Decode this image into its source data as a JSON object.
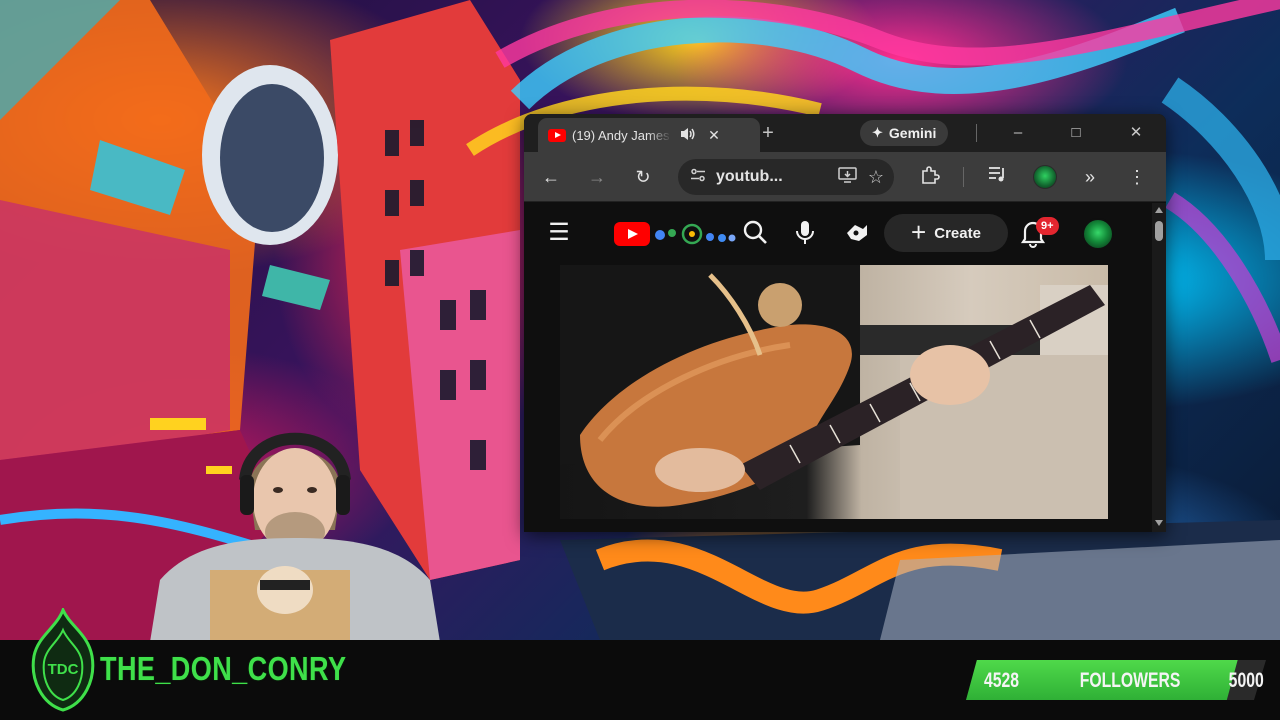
{
  "browser": {
    "tab": {
      "title": "(19) Andy James",
      "audio_icon": "speaker-icon",
      "close_icon": "close-icon"
    },
    "new_tab_label": "+",
    "gemini_label": "Gemini",
    "window_controls": {
      "minimize": "–",
      "maximize": "□",
      "close": "✕"
    },
    "toolbar": {
      "url": "youtub...",
      "icons": [
        "back-icon",
        "forward-icon",
        "reload-icon",
        "site-info-icon",
        "install-app-icon",
        "bookmark-star-icon",
        "extensions-icon",
        "media-control-icon",
        "profile-avatar-icon",
        "more-chevrons-icon",
        "kebab-menu-icon"
      ]
    }
  },
  "youtube": {
    "create_label": "Create",
    "notification_count": "9+",
    "icons": [
      "hamburger-menu-icon",
      "youtube-logo-icon",
      "doodle-icon",
      "search-icon",
      "mic-icon",
      "ai-assistant-icon",
      "bell-icon",
      "account-avatar-icon"
    ],
    "video": {
      "content": "guitar-playing-video"
    }
  },
  "stream": {
    "channel_name": "THE_DON_CONRY",
    "logo_text": "TDC",
    "followers": {
      "label": "FOLLOWERS",
      "current": "4528",
      "goal": "5000",
      "current_value": 4528,
      "goal_value": 5000
    }
  },
  "colors": {
    "accent_green": "#3fe04a",
    "youtube_red": "#ff0000",
    "badge_red": "#e3262f"
  }
}
